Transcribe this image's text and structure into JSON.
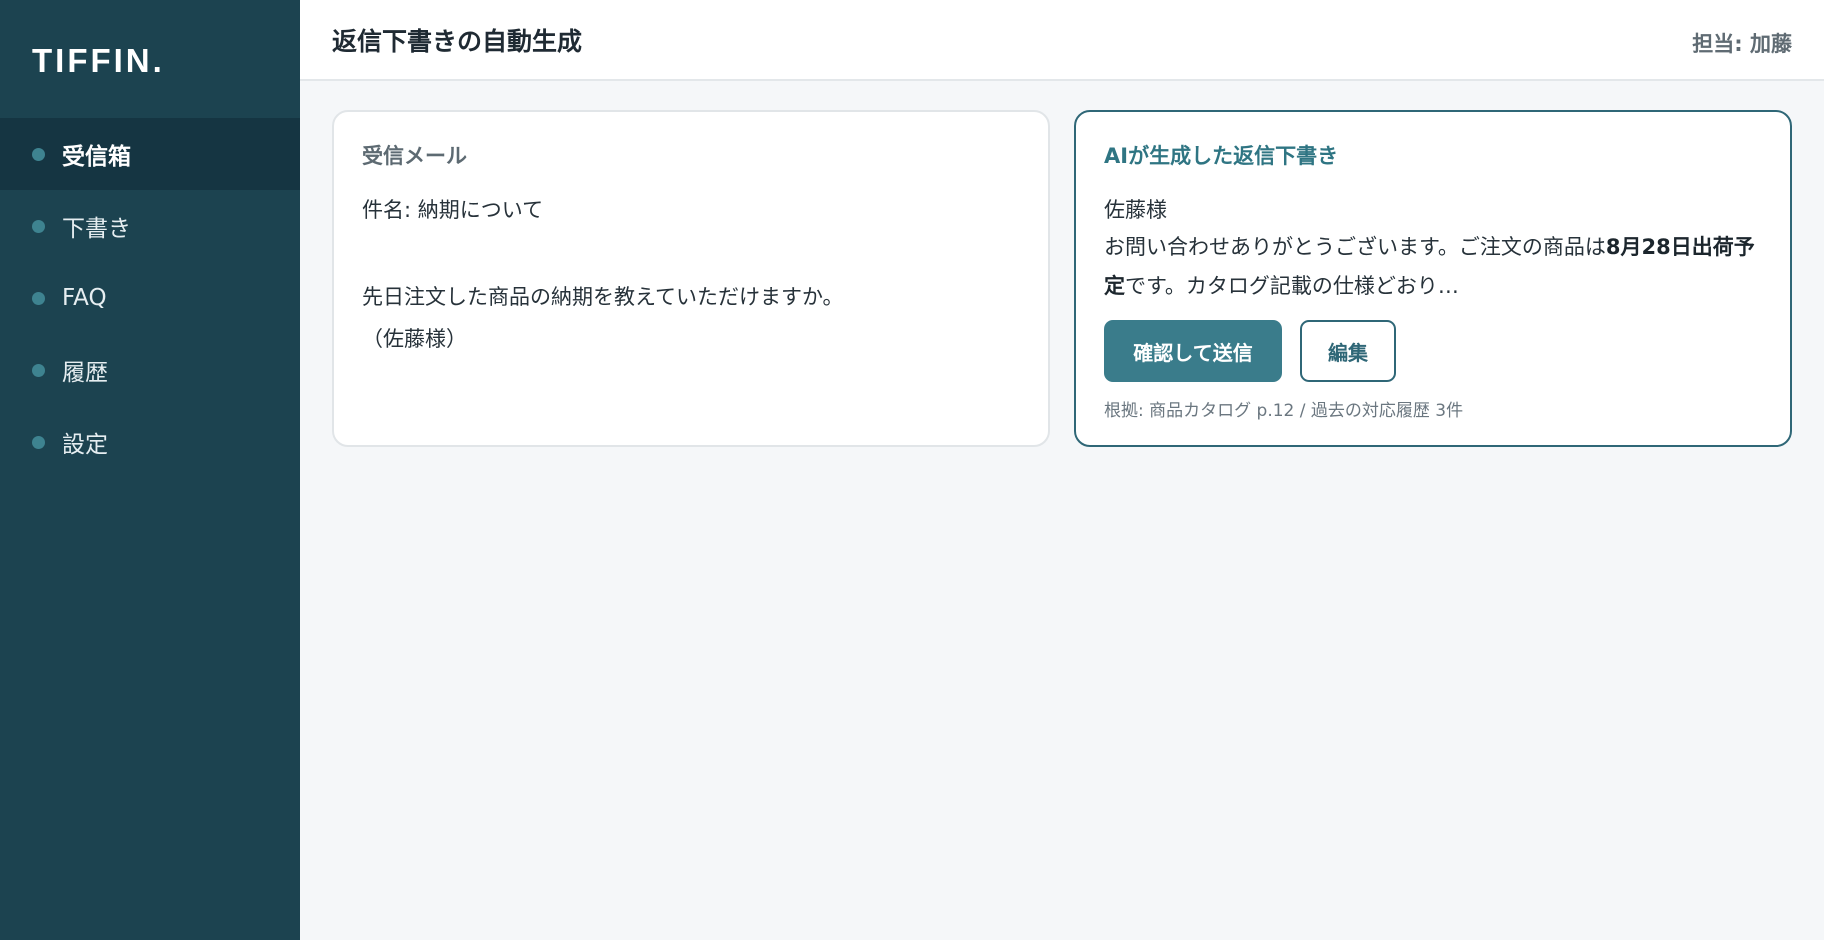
{
  "app": {
    "logo": "TIFFIN."
  },
  "sidebar": {
    "items": [
      {
        "label": "受信箱",
        "active": true
      },
      {
        "label": "下書き",
        "active": false
      },
      {
        "label": "FAQ",
        "active": false
      },
      {
        "label": "履歴",
        "active": false
      },
      {
        "label": "設定",
        "active": false
      }
    ]
  },
  "header": {
    "title": "返信下書きの自動生成",
    "assignee": "担当: 加藤"
  },
  "inbox_card": {
    "title": "受信メール",
    "subject": "件名: 納期について",
    "body_line1": "先日注文した商品の納期を教えていただけますか。",
    "body_line2": "（佐藤様）"
  },
  "draft_card": {
    "title": "AIが生成した返信下書き",
    "greeting": "佐藤様",
    "body_before": "お問い合わせありがとうございます。ご注文の商品は",
    "body_bold": "8月28日出荷予定",
    "body_after": "です。カタログ記載の仕様どおり…",
    "send_label": "確認して送信",
    "edit_label": "編集",
    "sources": "根拠: 商品カタログ p.12 / 過去の対応履歴 3件"
  },
  "colors": {
    "sidebar_bg": "#1c4350",
    "sidebar_active_bg": "#153542",
    "accent": "#3a7c8b",
    "accent_border": "#2f6777"
  },
  "icons": {
    "nav_marker": "dot-icon"
  }
}
